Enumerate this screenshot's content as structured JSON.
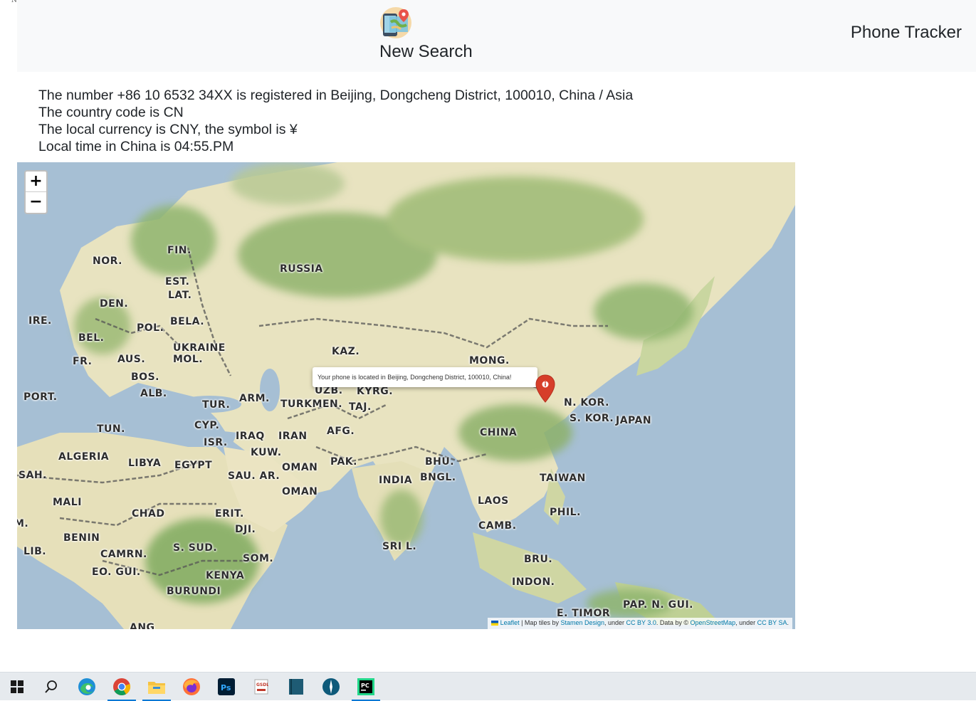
{
  "corner_mark": "N",
  "header": {
    "new_search": "New Search",
    "app_title": "Phone Tracker"
  },
  "info": {
    "line1": "The number +86 10 6532 34XX is registered in Beijing, Dongcheng District, 100010, China / Asia",
    "line2": "The country code is CN",
    "line3": "The local currency is CNY, the symbol is ¥",
    "line4": "Local time in China is 04:55.PM"
  },
  "map": {
    "zoom_in": "+",
    "zoom_out": "−",
    "popup": "Your phone is located in Beijing, Dongcheng District, 100010, China!",
    "attribution": {
      "leaflet": "Leaflet",
      "tiles_prefix": " | Map tiles by ",
      "stamen": "Stamen Design",
      "under1": ", under ",
      "ccby": "CC BY 3.0",
      "data": ". Data by © ",
      "osm": "OpenStreetMap",
      "under2": ", under ",
      "ccbysa": "CC BY SA",
      "end": "."
    },
    "labels": {
      "fin": "FIN.",
      "nor": "NOR.",
      "russia": "RUSSIA",
      "est": "EST.",
      "lat": "LAT.",
      "den": "DEN.",
      "ire": "IRE.",
      "pol": "POL.",
      "bela": "BELA.",
      "bel": "BEL.",
      "ukraine": "UKRAINE",
      "kaz": "KAZ.",
      "fr": "FR.",
      "aus": "AUS.",
      "mol": "MOL.",
      "mong": "MONG.",
      "bos": "BOS.",
      "port": "PORT.",
      "alb": "ALB.",
      "uzb": "UZB.",
      "kyrg": "KYRG.",
      "arm": "ARM.",
      "tur": "TUR.",
      "turkmen": "TURKMEN.",
      "taj": "TAJ.",
      "nkor": "N. KOR.",
      "skor": "S. KOR.",
      "japan": "JAPAN",
      "tun": "TUN.",
      "cyp": "CYP.",
      "iraq": "IRAQ",
      "iran": "IRAN",
      "afg": "AFG.",
      "china": "CHINA",
      "isr": "ISR.",
      "kuw": "KUW.",
      "algeria": "ALGERIA",
      "libya": "LIBYA",
      "egypt": "EGYPT",
      "oman1": "OMAN",
      "pak": "PAK.",
      "bhu": "BHU.",
      "sah": "SAH.",
      "sauar": "SAU. AR.",
      "india": "INDIA",
      "bngl": "BNGL.",
      "taiwan": "TAIWAN",
      "oman2": "OMAN",
      "mali": "MALI",
      "laos": "LAOS",
      "chad": "CHAD",
      "erit": "ERIT.",
      "phil": "PHIL.",
      "dji": "DJI.",
      "camb": "CAMB.",
      "benin": "BENIN",
      "ssud": "S. SUD.",
      "sril": "SRI L.",
      "lib": "LIB.",
      "camrn": "CAMRN.",
      "som": "SOM.",
      "bru": "BRU.",
      "eogui": "EO. GUI.",
      "kenya": "KENYA",
      "indon": "INDON.",
      "burundi": "BURUNDI",
      "papngui": "PAP. N. GUI.",
      "etimor": "E. TIMOR",
      "ang": "ANG",
      "m": "M."
    }
  },
  "taskbar": {
    "items": [
      "start-icon",
      "search-icon",
      "edge-icon",
      "chrome-icon",
      "file-explorer-icon",
      "firefox-icon",
      "photoshop-icon",
      "app-icon",
      "book-app-icon",
      "compass-app-icon",
      "pycharm-icon"
    ]
  }
}
